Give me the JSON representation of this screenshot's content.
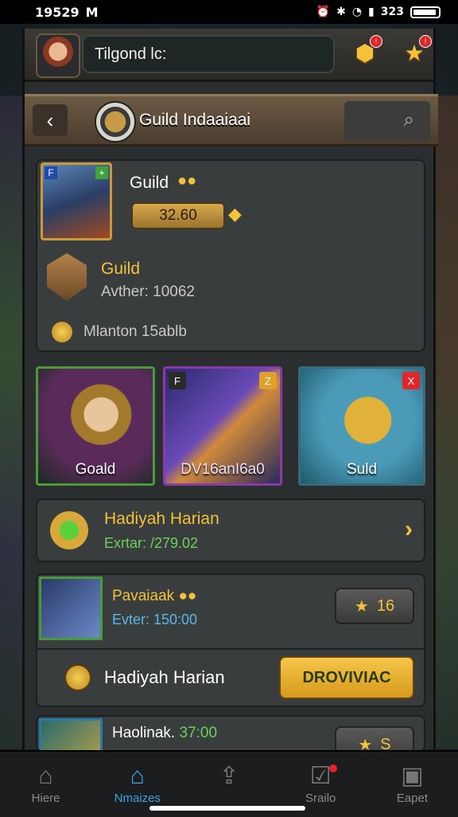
{
  "status_bar": {
    "time": "19529",
    "carrier_glyph": "M",
    "right_text": "323"
  },
  "topbar": {
    "search_text": "Tilgond lc:",
    "icons": [
      "avatar",
      "shield-badge-icon",
      "star-badge-icon"
    ]
  },
  "header": {
    "back": "‹",
    "title": "Guild Indaaiaai"
  },
  "profile": {
    "name": "Guild",
    "coins": "3​2.60",
    "guild_label": "Guild",
    "guild_stat": "Avther: 10062",
    "member_text": "Mlanton 15ablb"
  },
  "tiles": [
    {
      "label": "Goald",
      "tag": "",
      "tag_color": "#3fa23a"
    },
    {
      "label": "DV16anI6a0",
      "tag": "Z",
      "tag_color": "#e0a02a"
    },
    {
      "label": "Suld",
      "tag": "X",
      "tag_color": "#e0262a"
    }
  ],
  "daily": {
    "title": "Hadiyah Harian",
    "subtitle": "Exrtar: /279.02"
  },
  "quest": {
    "title": "Pavaiaak",
    "subtitle": "Evter: 150:00",
    "star_value": "16",
    "row_title": "Hadiyah Harian",
    "button": "DROVIVIAC"
  },
  "quest2": {
    "title": "Haolinak.",
    "value": "37:00",
    "star_value": "S"
  },
  "bottom_nav": [
    {
      "label": "Hiere",
      "icon": "home-icon"
    },
    {
      "label": "Nmaizes",
      "icon": "guild-home-icon"
    },
    {
      "label": "",
      "icon": "upload-icon"
    },
    {
      "label": "Srailo",
      "icon": "tasks-icon"
    },
    {
      "label": "Eapet",
      "icon": "profile-icon"
    }
  ]
}
